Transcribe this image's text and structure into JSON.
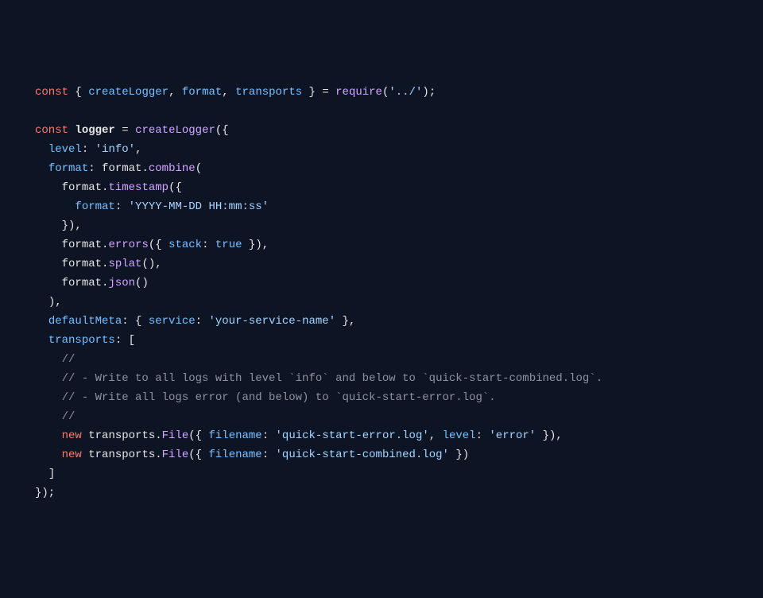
{
  "code": {
    "l1": {
      "kw1": "const",
      "d1": "createLogger",
      "d2": "format",
      "d3": "transports",
      "fn": "require",
      "path": "'../'"
    },
    "l2": {
      "kw1": "const",
      "name": "logger",
      "fn": "createLogger"
    },
    "l3": {
      "key": "level",
      "val": "'info'"
    },
    "l4": {
      "key": "format",
      "obj": "format",
      "fn": "combine"
    },
    "l5": {
      "obj": "format",
      "fn": "timestamp"
    },
    "l6": {
      "key": "format",
      "val": "'YYYY-MM-DD HH:mm:ss'"
    },
    "l7": {
      "close": "}),"
    },
    "l8": {
      "obj": "format",
      "fn": "errors",
      "key": "stack",
      "val": "true"
    },
    "l9": {
      "obj": "format",
      "fn": "splat"
    },
    "l10": {
      "obj": "format",
      "fn": "json"
    },
    "l11": {
      "close": "),"
    },
    "l12": {
      "key": "defaultMeta",
      "ikey": "service",
      "val": "'your-service-name'"
    },
    "l13": {
      "key": "transports"
    },
    "c1": "//",
    "c2": "// - Write to all logs with level `info` and below to `quick-start-combined.log`.",
    "c3": "// - Write all logs error (and below) to `quick-start-error.log`.",
    "c4": "//",
    "l18": {
      "kw": "new",
      "obj": "transports",
      "fn": "File",
      "k1": "filename",
      "v1": "'quick-start-error.log'",
      "k2": "level",
      "v2": "'error'"
    },
    "l19": {
      "kw": "new",
      "obj": "transports",
      "fn": "File",
      "k1": "filename",
      "v1": "'quick-start-combined.log'"
    },
    "l20": "]",
    "l21": "});"
  }
}
